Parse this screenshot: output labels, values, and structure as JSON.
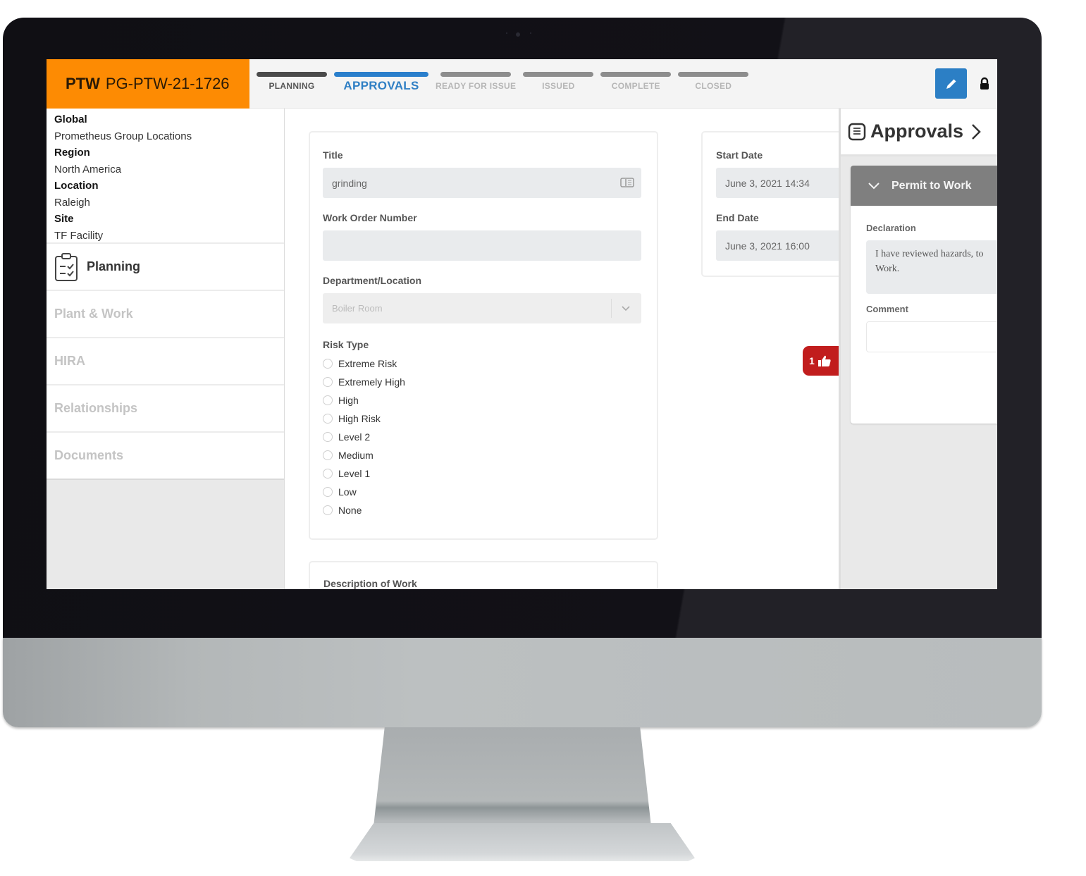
{
  "header": {
    "ptw_label": "PTW",
    "permit_id": "PG-PTW-21-1726",
    "steps": [
      {
        "label": "PLANNING",
        "state": "done"
      },
      {
        "label": "APPROVALS",
        "state": "active"
      },
      {
        "label": "READY FOR ISSUE",
        "state": "pending"
      },
      {
        "label": "ISSUED",
        "state": "pending"
      },
      {
        "label": "COMPLETE",
        "state": "pending"
      },
      {
        "label": "CLOSED",
        "state": "pending"
      }
    ],
    "edit_icon": "pencil-icon",
    "lock_icon": "lock-icon"
  },
  "sidebar": {
    "location": [
      {
        "key": "Global",
        "value": "Prometheus Group Locations"
      },
      {
        "key": "Region",
        "value": "North America"
      },
      {
        "key": "Location",
        "value": "Raleigh"
      },
      {
        "key": "Site",
        "value": "TF Facility"
      }
    ],
    "nav": [
      {
        "label": "Planning",
        "active": true,
        "icon": "clipboard-check-icon"
      },
      {
        "label": "Plant & Work",
        "active": false
      },
      {
        "label": "HIRA",
        "active": false
      },
      {
        "label": "Relationships",
        "active": false
      },
      {
        "label": "Documents",
        "active": false
      }
    ]
  },
  "form": {
    "title_label": "Title",
    "title_value": "grinding",
    "work_order_label": "Work Order Number",
    "work_order_value": "",
    "department_label": "Department/Location",
    "department_value": "Boiler Room",
    "risk_type_label": "Risk Type",
    "risk_options": [
      "Extreme Risk",
      "Extremely High",
      "High",
      "High Risk",
      "Level 2",
      "Medium",
      "Level 1",
      "Low",
      "None"
    ],
    "start_date_label": "Start Date",
    "start_date_value": "June 3, 2021 14:34",
    "end_date_label": "End Date",
    "end_date_value": "June 3, 2021 16:00",
    "description_label": "Description of Work"
  },
  "like_badge": {
    "count": "1",
    "icon": "thumbs-up-icon",
    "color": "#c11d1d"
  },
  "approvals": {
    "title": "Approvals",
    "section_title": "Permit to Work",
    "declaration_label": "Declaration",
    "declaration_text": "I have reviewed hazards, to Work.",
    "comment_label": "Comment",
    "comment_value": ""
  },
  "colors": {
    "brand_orange": "#fd8b03",
    "accent_blue": "#2c7fc5",
    "alert_red": "#c11d1d"
  }
}
